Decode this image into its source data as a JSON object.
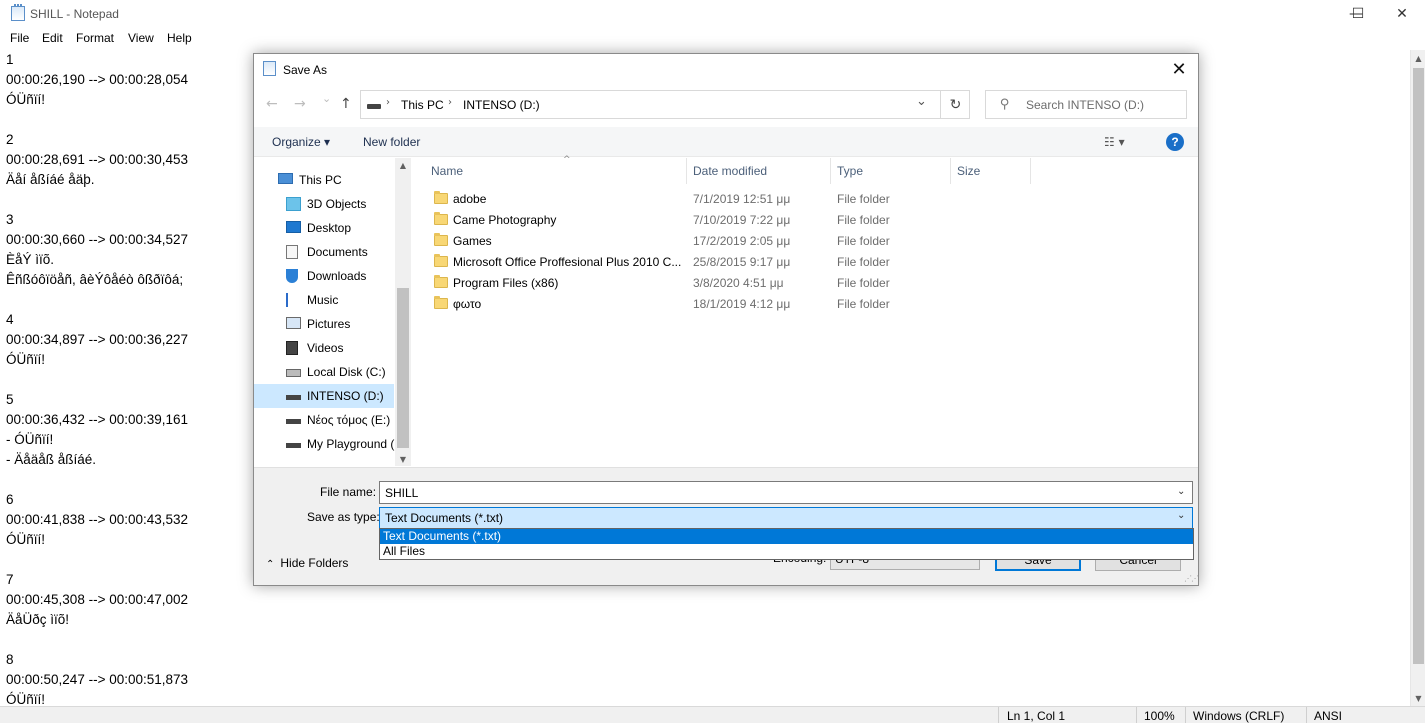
{
  "notepad": {
    "title": "SHILL - Notepad",
    "controls": {
      "minimize": "—",
      "maximize": "☐",
      "close": "✕"
    },
    "menu": [
      "File",
      "Edit",
      "Format",
      "View",
      "Help"
    ],
    "lines": [
      "1",
      "00:00:26,190 --> 00:00:28,054",
      "ÓÜñïí!",
      "",
      "2",
      "00:00:28,691 --> 00:00:30,453",
      "Äåí åßíáé åäþ.",
      "",
      "3",
      "00:00:30,660 --> 00:00:34,527",
      "ÈåÝ ìïõ.",
      "Êñßóôïöåñ, âèÝôåéò ôßðïôá;",
      "",
      "4",
      "00:00:34,897 --> 00:00:36,227",
      "ÓÜñïí!",
      "",
      "5",
      "00:00:36,432 --> 00:00:39,161",
      "- ÓÜñïí!",
      "- Äåäåß åßíáé.",
      "",
      "6",
      "00:00:41,838 --> 00:00:43,532",
      "ÓÜñïí!",
      "",
      "7",
      "00:00:45,308 --> 00:00:47,002",
      "ÄåÜðç ìïõ!",
      "",
      "8",
      "00:00:50,247 --> 00:00:51,873",
      "ÓÜñïí!"
    ],
    "status": {
      "position": "Ln 1, Col 1",
      "zoom": "100%",
      "line_ending": "Windows (CRLF)",
      "encoding": "ANSI"
    }
  },
  "dialog": {
    "title": "Save As",
    "close": "✕",
    "nav": {
      "back": "←",
      "forward": "→",
      "dropdown": "⌄",
      "up": "↑"
    },
    "address": {
      "crumbs": [
        "This PC",
        "INTENSO (D:)"
      ],
      "separator": "›",
      "dropdown": "⌄",
      "refresh": "↻"
    },
    "search_placeholder": "Search INTENSO (D:)",
    "toolbar": {
      "organize": "Organize ▾",
      "new_folder": "New folder",
      "view": "☷ ▾",
      "help": "?"
    },
    "nav_pane": [
      {
        "label": "This PC",
        "icon": "computer-icon",
        "selected": false
      },
      {
        "label": "3D Objects",
        "icon": "3d-objects-icon",
        "selected": false
      },
      {
        "label": "Desktop",
        "icon": "desktop-icon",
        "selected": false
      },
      {
        "label": "Documents",
        "icon": "documents-icon",
        "selected": false
      },
      {
        "label": "Downloads",
        "icon": "downloads-icon",
        "selected": false
      },
      {
        "label": "Music",
        "icon": "music-icon",
        "selected": false
      },
      {
        "label": "Pictures",
        "icon": "pictures-icon",
        "selected": false
      },
      {
        "label": "Videos",
        "icon": "videos-icon",
        "selected": false
      },
      {
        "label": "Local Disk (C:)",
        "icon": "local-disk-icon",
        "selected": false
      },
      {
        "label": "INTENSO (D:)",
        "icon": "usb-drive-icon",
        "selected": true
      },
      {
        "label": "Νέος τόμος (E:)",
        "icon": "drive-icon",
        "selected": false
      },
      {
        "label": "My Playground (",
        "icon": "drive-icon",
        "selected": false
      }
    ],
    "columns": [
      "Name",
      "Date modified",
      "Type",
      "Size"
    ],
    "files": [
      {
        "name": "adobe",
        "date": "7/1/2019 12:51 μμ",
        "type": "File folder"
      },
      {
        "name": "Came Photography",
        "date": "7/10/2019 7:22 μμ",
        "type": "File folder"
      },
      {
        "name": "Games",
        "date": "17/2/2019 2:05 μμ",
        "type": "File folder"
      },
      {
        "name": "Microsoft Office Proffesional Plus 2010 C...",
        "date": "25/8/2015 9:17 μμ",
        "type": "File folder"
      },
      {
        "name": "Program Files (x86)",
        "date": "3/8/2020 4:51 μμ",
        "type": "File folder"
      },
      {
        "name": "φωτο",
        "date": "18/1/2019 4:12 μμ",
        "type": "File folder"
      }
    ],
    "file_name_label": "File name:",
    "file_name_value": "SHILL",
    "save_type_label": "Save as type:",
    "save_type_value": "Text Documents (*.txt)",
    "save_type_options": [
      "Text Documents (*.txt)",
      "All Files"
    ],
    "encoding_label": "Encoding:",
    "encoding_value": "UTF-8",
    "save_label": "Save",
    "cancel_label": "Cancel",
    "hide_folders": "Hide Folders",
    "colors": {
      "accent": "#0078d7",
      "selection": "#cce8ff",
      "folder": "#f8d775"
    }
  }
}
